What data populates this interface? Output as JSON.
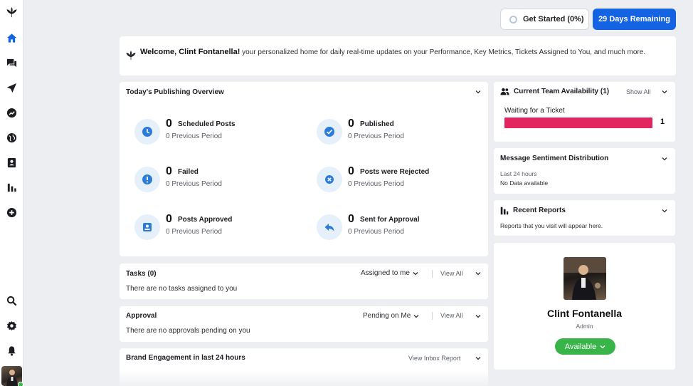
{
  "header": {
    "get_started_label": "Get Started (0%)",
    "days_remaining_label": "29 Days Remaining"
  },
  "welcome": {
    "greeting": "Welcome, Clint Fontanella!",
    "message": "your personalized home for daily real-time updates on your Performance, Key Metrics, Tickets Assigned to You, and much more."
  },
  "publishing": {
    "title": "Today's Publishing Overview",
    "stats": [
      {
        "value": "0",
        "label": "Scheduled Posts",
        "sub": "0 Previous Period",
        "icon": "clock-icon"
      },
      {
        "value": "0",
        "label": "Published",
        "sub": "0 Previous Period",
        "icon": "check-circle-icon"
      },
      {
        "value": "0",
        "label": "Failed",
        "sub": "0 Previous Period",
        "icon": "exclamation-icon"
      },
      {
        "value": "0",
        "label": "Posts were Rejected",
        "sub": "0 Previous Period",
        "icon": "x-circle-icon"
      },
      {
        "value": "0",
        "label": "Posts Approved",
        "sub": "0 Previous Period",
        "icon": "approved-icon"
      },
      {
        "value": "0",
        "label": "Sent for Approval",
        "sub": "0 Previous Period",
        "icon": "reply-icon"
      }
    ]
  },
  "tasks": {
    "title": "Tasks (0)",
    "filter": "Assigned to me",
    "view_all": "View All",
    "empty": "There are no tasks assigned to you"
  },
  "approval": {
    "title": "Approval",
    "filter": "Pending on Me",
    "view_all": "View All",
    "empty": "There are no approvals pending on you"
  },
  "engagement": {
    "title": "Brand Engagement in last 24 hours",
    "link": "View Inbox Report"
  },
  "team": {
    "title": "Current Team Availability (1)",
    "show_all": "Show All",
    "status_label": "Waiting for a Ticket",
    "count": "1",
    "bar_fraction": 1.0,
    "bar_color": "#e3255f"
  },
  "sentiment": {
    "title": "Message Sentiment Distribution",
    "period": "Last 24 hours",
    "empty": "No Data available"
  },
  "reports": {
    "title": "Recent Reports",
    "empty": "Reports that you visit will appear here."
  },
  "profile": {
    "name": "Clint Fontanella",
    "role": "Admin",
    "status": "Available",
    "status_color": "#38b449"
  },
  "colors": {
    "primary": "#1463e3",
    "icon_blue": "#2b7bd9",
    "icon_bg": "#e6f0fb"
  }
}
